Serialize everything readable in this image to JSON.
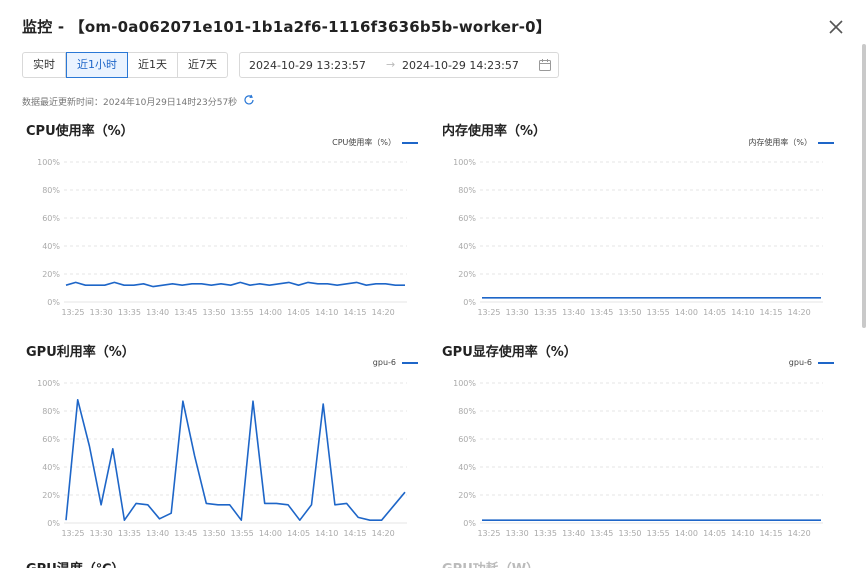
{
  "window": {
    "title": "监控 - 【om-0a062071e101-1b1a2f6-1116f3636b5b-worker-0】",
    "close_icon": "close-icon"
  },
  "toolbar": {
    "ranges": [
      "实时",
      "近1小时",
      "近1天",
      "近7天"
    ],
    "active_range": "近1小时",
    "start_time": "2024-10-29 13:23:57",
    "separator": "→",
    "end_time": "2024-10-29 14:23:57",
    "calendar_icon": "calendar-icon"
  },
  "status": {
    "updated_text": "数据最近更新时间：2024年10月29日14时23分57秒",
    "refresh_icon": "refresh-icon"
  },
  "colors": {
    "accent": "#1e66c8",
    "grid": "#e4e4e4",
    "axis_text": "#aaaaaa"
  },
  "panels": [
    {
      "title": "CPU使用率（%）",
      "legend": "CPU使用率（%）"
    },
    {
      "title": "内存使用率（%）",
      "legend": "内存使用率（%）"
    },
    {
      "title": "GPU利用率（%）",
      "legend": "gpu-6"
    },
    {
      "title": "GPU显存使用率（%）",
      "legend": "gpu-6"
    }
  ],
  "bottom_titles": [
    "GPU温度（℃）",
    "GPU功耗（W）"
  ],
  "chart_data": [
    {
      "type": "line",
      "title": "CPU使用率（%）",
      "x": [
        "13:25",
        "13:30",
        "13:35",
        "13:40",
        "13:45",
        "13:50",
        "13:55",
        "14:00",
        "14:05",
        "14:10",
        "14:15",
        "14:20"
      ],
      "yticks": [
        "0%",
        "20%",
        "40%",
        "60%",
        "80%",
        "100%"
      ],
      "ylim": [
        0,
        100
      ],
      "series": [
        {
          "name": "CPU使用率（%）",
          "values": [
            12,
            14,
            12,
            12,
            12,
            14,
            12,
            12,
            13,
            11,
            12,
            13,
            12,
            13,
            13,
            12,
            13,
            12,
            14,
            12,
            13,
            12,
            13,
            14,
            12,
            14,
            13,
            13,
            12,
            13,
            14,
            12,
            13,
            13,
            12,
            12
          ]
        }
      ]
    },
    {
      "type": "line",
      "title": "内存使用率（%）",
      "x": [
        "13:25",
        "13:30",
        "13:35",
        "13:40",
        "13:45",
        "13:50",
        "13:55",
        "14:00",
        "14:05",
        "14:10",
        "14:15",
        "14:20"
      ],
      "yticks": [
        "0%",
        "20%",
        "40%",
        "60%",
        "80%",
        "100%"
      ],
      "ylim": [
        0,
        100
      ],
      "series": [
        {
          "name": "内存使用率（%）",
          "values": [
            3,
            3,
            3,
            3,
            3,
            3,
            3,
            3,
            3,
            3,
            3,
            3,
            3,
            3,
            3,
            3,
            3,
            3,
            3,
            3,
            3,
            3,
            3,
            3,
            3,
            3,
            3,
            3,
            3,
            3,
            3,
            3,
            3,
            3,
            3,
            3
          ]
        }
      ]
    },
    {
      "type": "line",
      "title": "GPU利用率（%）",
      "x": [
        "13:25",
        "13:30",
        "13:35",
        "13:40",
        "13:45",
        "13:50",
        "13:55",
        "14:00",
        "14:05",
        "14:10",
        "14:15",
        "14:20"
      ],
      "yticks": [
        "0%",
        "20%",
        "40%",
        "60%",
        "80%",
        "100%"
      ],
      "ylim": [
        0,
        100
      ],
      "series": [
        {
          "name": "gpu-6",
          "values": [
            2,
            88,
            55,
            13,
            53,
            2,
            14,
            13,
            3,
            7,
            87,
            48,
            14,
            13,
            13,
            2,
            87,
            14,
            14,
            13,
            2,
            13,
            85,
            13,
            14,
            4,
            2,
            2,
            12,
            22
          ]
        }
      ]
    },
    {
      "type": "line",
      "title": "GPU显存使用率（%）",
      "x": [
        "13:25",
        "13:30",
        "13:35",
        "13:40",
        "13:45",
        "13:50",
        "13:55",
        "14:00",
        "14:05",
        "14:10",
        "14:15",
        "14:20"
      ],
      "yticks": [
        "0%",
        "20%",
        "40%",
        "60%",
        "80%",
        "100%"
      ],
      "ylim": [
        0,
        100
      ],
      "series": [
        {
          "name": "gpu-6",
          "values": [
            2,
            2,
            2,
            2,
            2,
            2,
            2,
            2,
            2,
            2,
            2,
            2,
            2,
            2,
            2,
            2,
            2,
            2,
            2,
            2,
            2,
            2,
            2,
            2,
            2,
            2,
            2,
            2,
            2,
            2,
            2,
            2,
            2,
            2,
            2,
            2
          ]
        }
      ]
    }
  ]
}
